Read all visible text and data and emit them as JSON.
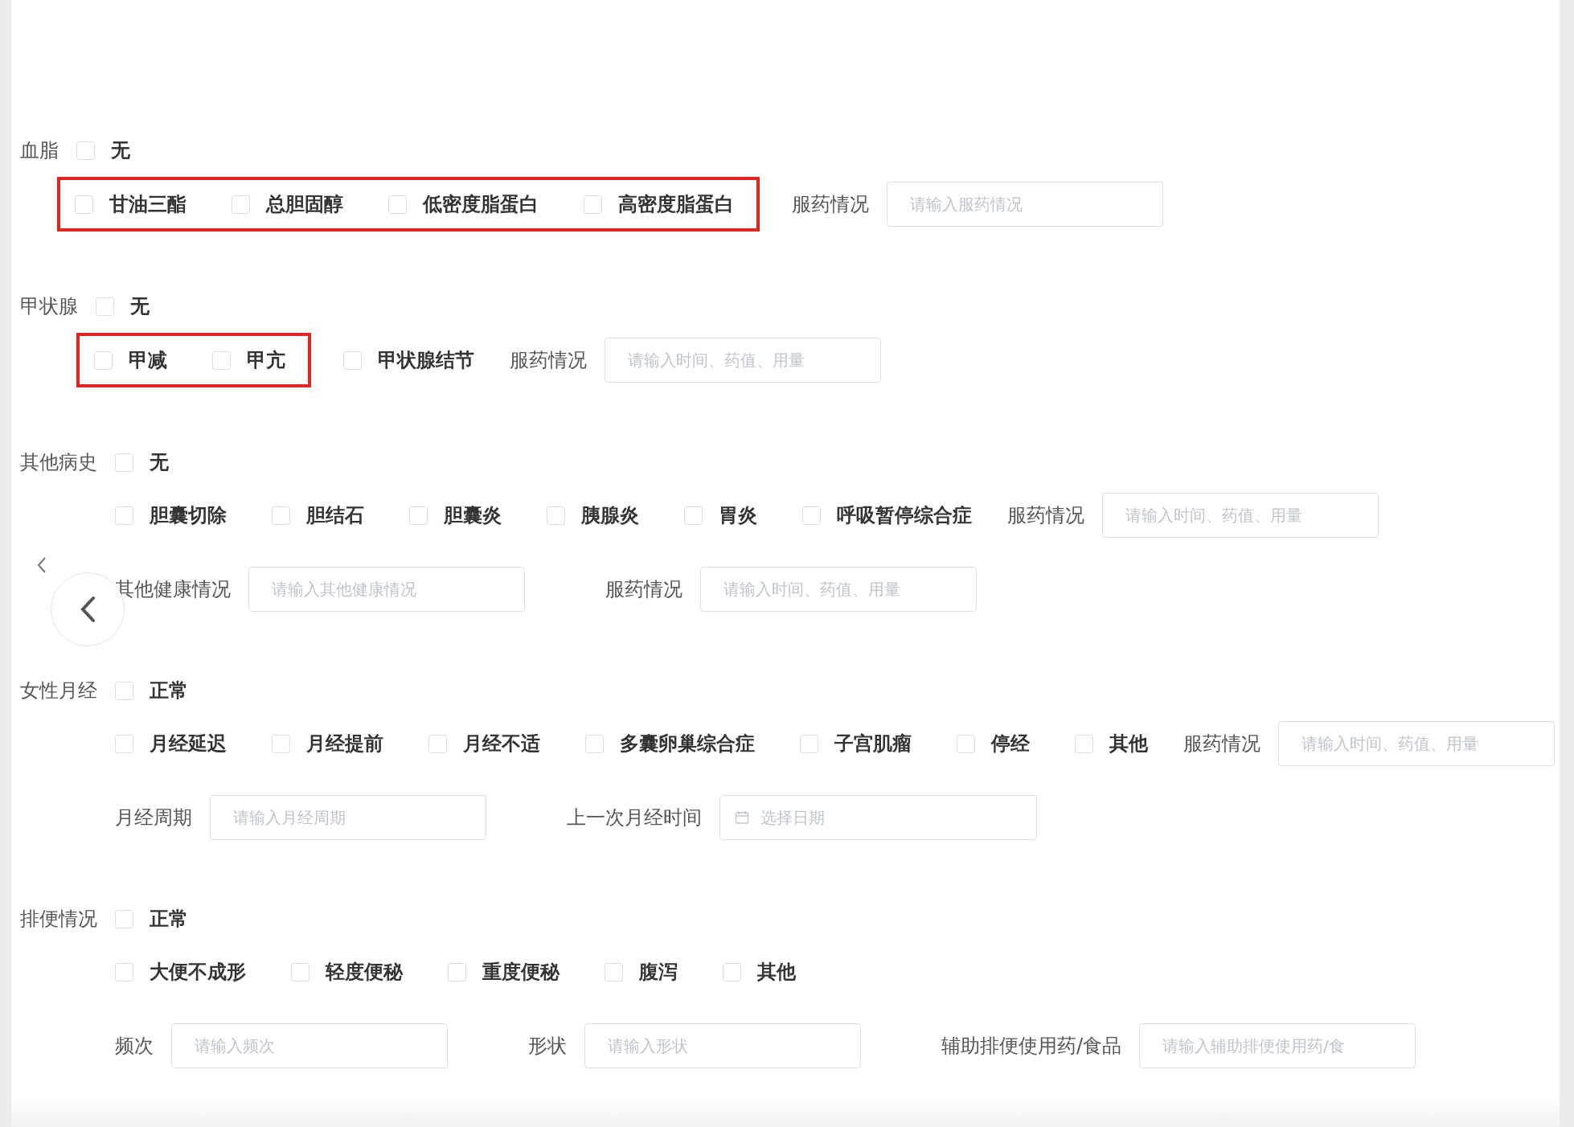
{
  "sections": [
    {
      "label": "血脂",
      "none_option": {
        "label": "无",
        "checked": false
      },
      "rows": [
        {
          "items": [
            {
              "kind": "options",
              "highlighted": true,
              "options": [
                {
                  "label": "甘油三酯",
                  "checked": false
                },
                {
                  "label": "总胆固醇",
                  "checked": false
                },
                {
                  "label": "低密度脂蛋白",
                  "checked": false
                },
                {
                  "label": "高密度脂蛋白",
                  "checked": false
                }
              ]
            },
            {
              "kind": "field",
              "label": "服药情况",
              "placeholder": "请输入服药情况"
            }
          ]
        }
      ]
    },
    {
      "label": "甲状腺",
      "none_option": {
        "label": "无",
        "checked": false
      },
      "rows": [
        {
          "items": [
            {
              "kind": "options",
              "highlighted": true,
              "options": [
                {
                  "label": "甲减",
                  "checked": false
                },
                {
                  "label": "甲亢",
                  "checked": false
                }
              ]
            },
            {
              "kind": "options",
              "highlighted": false,
              "options": [
                {
                  "label": "甲状腺结节",
                  "checked": false
                }
              ]
            },
            {
              "kind": "field",
              "label": "服药情况",
              "placeholder": "请输入时间、药值、用量"
            }
          ]
        }
      ]
    },
    {
      "label": "其他病史",
      "none_option": {
        "label": "无",
        "checked": false
      },
      "rows": [
        {
          "items": [
            {
              "kind": "options",
              "highlighted": false,
              "options": [
                {
                  "label": "胆囊切除",
                  "checked": false
                },
                {
                  "label": "胆结石",
                  "checked": false
                },
                {
                  "label": "胆囊炎",
                  "checked": false
                },
                {
                  "label": "胰腺炎",
                  "checked": false
                },
                {
                  "label": "胃炎",
                  "checked": false
                },
                {
                  "label": "呼吸暂停综合症",
                  "checked": false
                }
              ]
            },
            {
              "kind": "field",
              "label": "服药情况",
              "placeholder": "请输入时间、药值、用量"
            }
          ]
        },
        {
          "items": [
            {
              "kind": "field",
              "label": "其他健康情况",
              "placeholder": "请输入其他健康情况"
            },
            {
              "kind": "field",
              "label": "服药情况",
              "placeholder": "请输入时间、药值、用量"
            }
          ]
        }
      ]
    },
    {
      "label": "女性月经",
      "none_option": {
        "label": "正常",
        "checked": false
      },
      "rows": [
        {
          "items": [
            {
              "kind": "options",
              "highlighted": false,
              "options": [
                {
                  "label": "月经延迟",
                  "checked": false
                },
                {
                  "label": "月经提前",
                  "checked": false
                },
                {
                  "label": "月经不适",
                  "checked": false
                },
                {
                  "label": "多囊卵巢综合症",
                  "checked": false
                },
                {
                  "label": "子宫肌瘤",
                  "checked": false
                },
                {
                  "label": "停经",
                  "checked": false
                },
                {
                  "label": "其他",
                  "checked": false
                }
              ]
            },
            {
              "kind": "field",
              "label": "服药情况",
              "placeholder": "请输入时间、药值、用量"
            }
          ]
        },
        {
          "items": [
            {
              "kind": "field",
              "label": "月经周期",
              "placeholder": "请输入月经周期"
            },
            {
              "kind": "date",
              "label": "上一次月经时间",
              "placeholder": "选择日期"
            }
          ]
        }
      ]
    },
    {
      "label": "排便情况",
      "none_option": {
        "label": "正常",
        "checked": false
      },
      "rows": [
        {
          "items": [
            {
              "kind": "options",
              "highlighted": false,
              "options": [
                {
                  "label": "大便不成形",
                  "checked": false
                },
                {
                  "label": "轻度便秘",
                  "checked": false
                },
                {
                  "label": "重度便秘",
                  "checked": false
                },
                {
                  "label": "腹泻",
                  "checked": false
                },
                {
                  "label": "其他",
                  "checked": false
                }
              ]
            }
          ]
        },
        {
          "items": [
            {
              "kind": "field",
              "label": "频次",
              "placeholder": "请输入频次"
            },
            {
              "kind": "field",
              "label": "形状",
              "placeholder": "请输入形状"
            },
            {
              "kind": "field",
              "label": "辅助排便使用药/食品",
              "placeholder": "请输入辅助排便使用药/食"
            }
          ]
        }
      ]
    }
  ]
}
